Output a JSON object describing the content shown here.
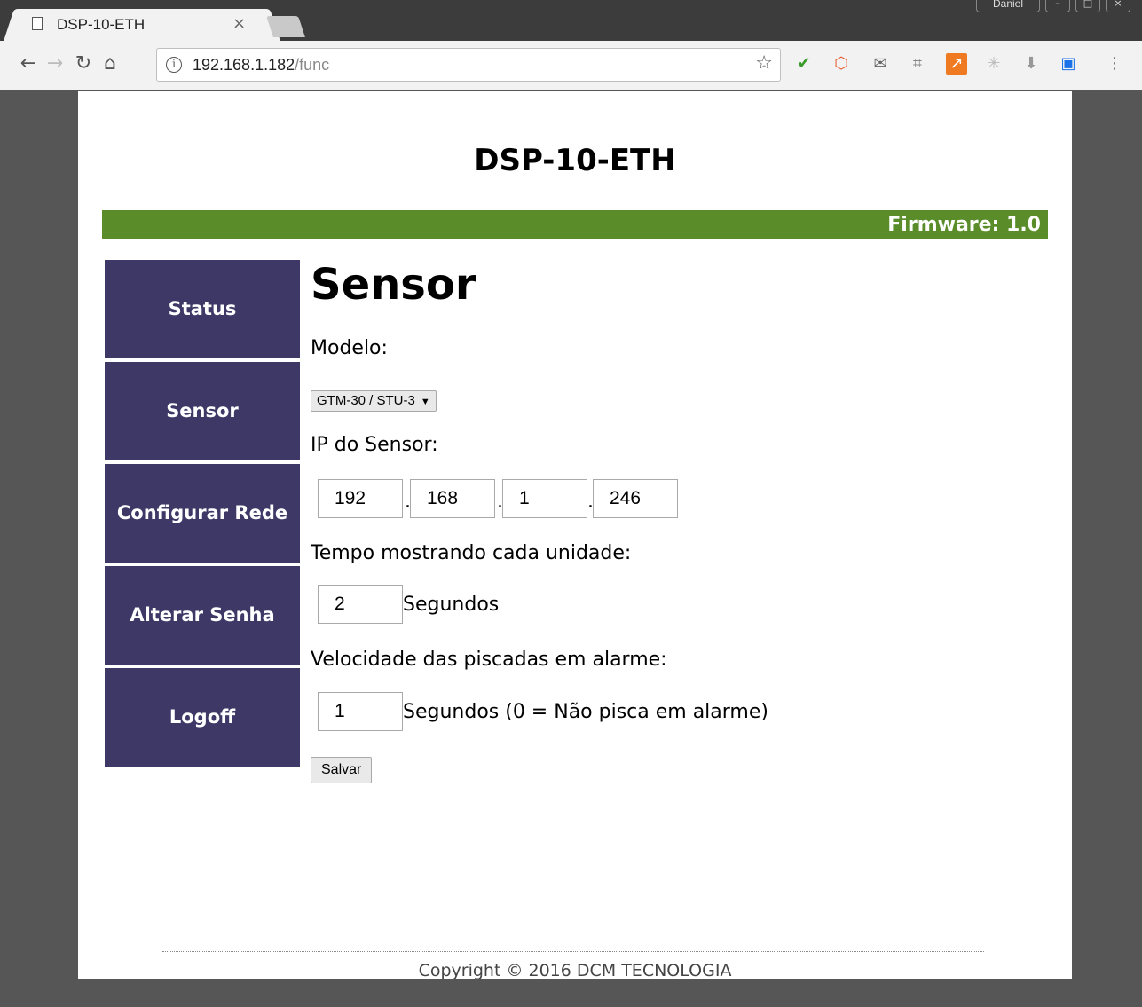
{
  "browser": {
    "tab_title": "DSP-10-ETH",
    "tab_close": "×",
    "profile": "Daniel",
    "url_host": "192.168.1.182",
    "url_path": "/func"
  },
  "page": {
    "site_title": "DSP-10-ETH",
    "firmware": "Firmware: 1.0",
    "menu": [
      {
        "label": "Status"
      },
      {
        "label": "Sensor"
      },
      {
        "label": "Configurar Rede"
      },
      {
        "label": "Alterar Senha"
      },
      {
        "label": "Logoff"
      }
    ],
    "heading": "Sensor",
    "model_label": "Modelo:",
    "model_value": "GTM-30 / STU-3",
    "ip_label": "IP do Sensor:",
    "ip": [
      "192",
      "168",
      "1",
      "246"
    ],
    "ip_dot": ".",
    "time_label": "Tempo mostrando cada unidade:",
    "time_value": "2",
    "time_unit": "Segundos",
    "blink_label": "Velocidade das piscadas em alarme:",
    "blink_value": "1",
    "blink_unit": "Segundos (0 = Não pisca em alarme)",
    "save_label": "Salvar",
    "copyright": "Copyright © 2016 DCM TECNOLOGIA"
  },
  "colors": {
    "menu_bg": "#3d3866",
    "green_bar": "#5a8d2a"
  }
}
